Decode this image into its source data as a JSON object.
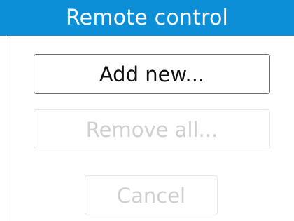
{
  "dialog": {
    "title": "Remote control",
    "buttons": {
      "add_new": "Add new...",
      "remove_all": "Remove all...",
      "cancel": "Cancel"
    }
  },
  "colors": {
    "titlebar": "#0d8fd8",
    "title_text": "#ffffff",
    "enabled_text": "#111111",
    "disabled_text": "#d0d0d0"
  }
}
